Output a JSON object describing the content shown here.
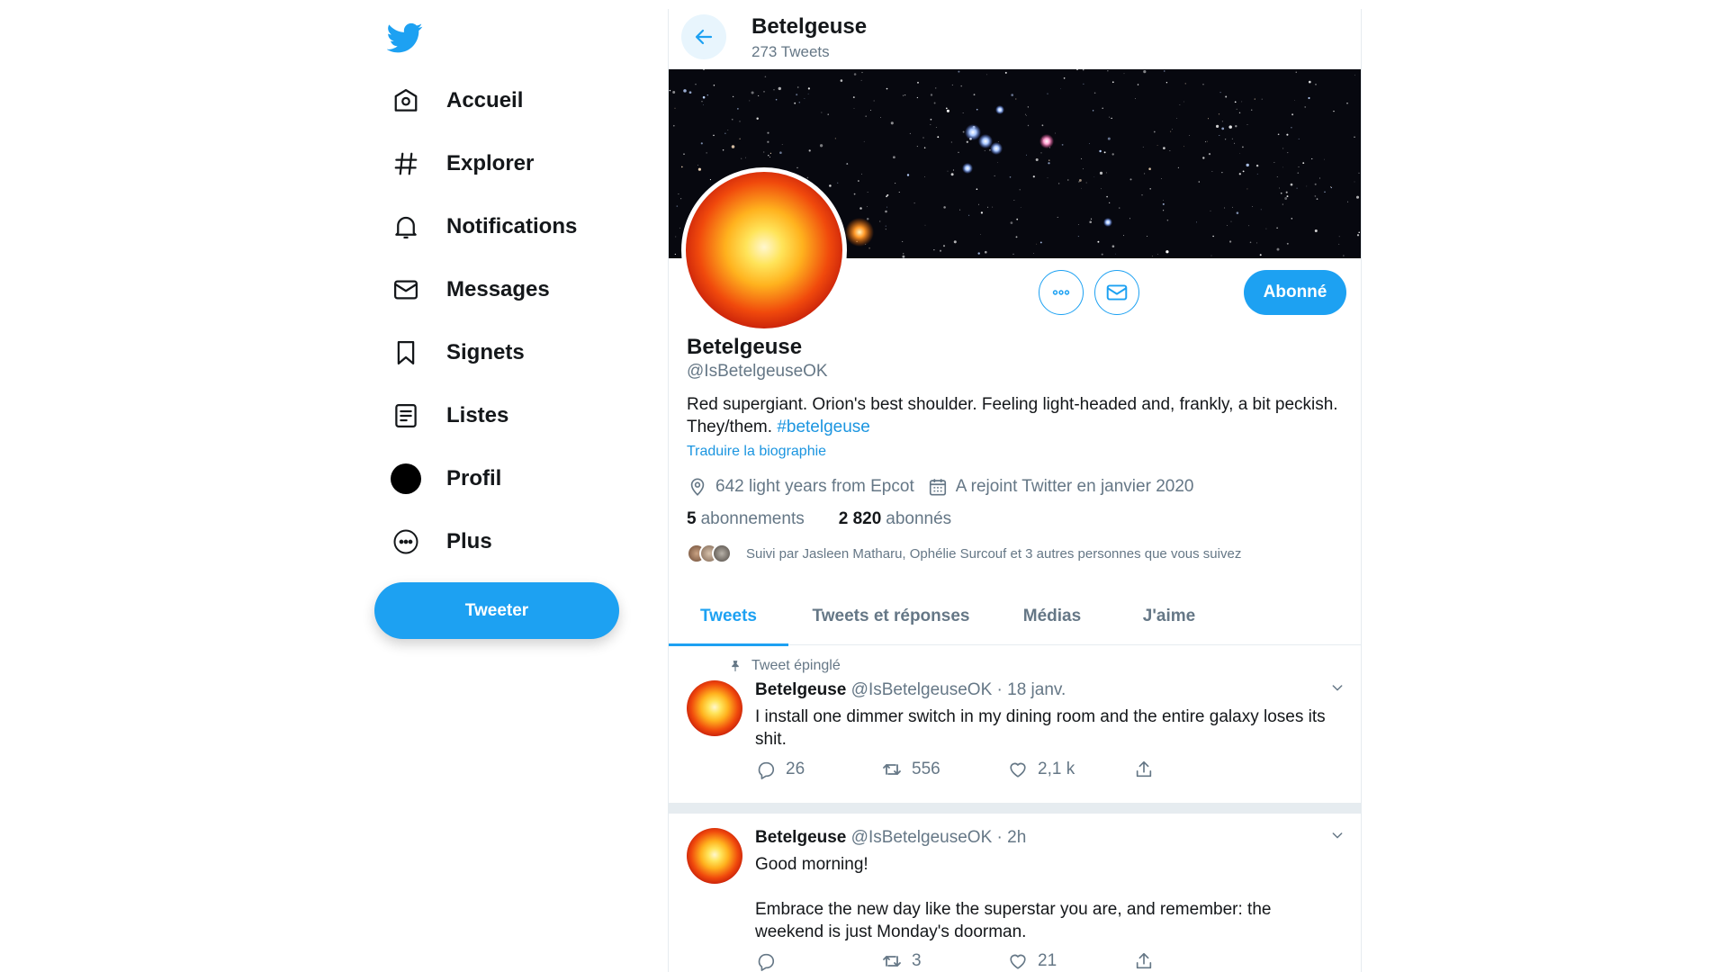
{
  "colors": {
    "accent": "#1da1f2",
    "link": "#1b95e0",
    "text": "#14171a",
    "muted": "#657786",
    "border": "#e6ecf0"
  },
  "sidebar": {
    "logo_icon": "twitter-bird-icon",
    "items": [
      {
        "label": "Accueil",
        "icon": "home-icon"
      },
      {
        "label": "Explorer",
        "icon": "hashtag-icon"
      },
      {
        "label": "Notifications",
        "icon": "bell-icon"
      },
      {
        "label": "Messages",
        "icon": "envelope-icon"
      },
      {
        "label": "Signets",
        "icon": "bookmark-icon"
      },
      {
        "label": "Listes",
        "icon": "list-icon"
      },
      {
        "label": "Profil",
        "icon": "profile-avatar-icon"
      },
      {
        "label": "Plus",
        "icon": "more-circle-icon"
      }
    ],
    "tweet_button": "Tweeter"
  },
  "header": {
    "title": "Betelgeuse",
    "subtitle": "273 Tweets"
  },
  "profile": {
    "name": "Betelgeuse",
    "handle": "@IsBetelgeuseOK",
    "bio_text": "Red supergiant. Orion's best shoulder. Feeling light-headed and, frankly, a bit peckish. They/them. ",
    "bio_hashtag": "#betelgeuse",
    "translate_link": "Traduire la biographie",
    "location": "642 light years from Epcot",
    "joined": "A rejoint Twitter en janvier 2020",
    "following_count": "5",
    "following_label": "abonnements",
    "followers_count": "2 820",
    "followers_label": "abonnés",
    "followed_by": "Suivi par Jasleen Matharu, Ophélie Surcouf et 3 autres personnes que vous suivez",
    "follow_button": "Abonné"
  },
  "tabs": [
    "Tweets",
    "Tweets et réponses",
    "Médias",
    "J'aime"
  ],
  "tweets": [
    {
      "pinned_label": "Tweet épinglé",
      "name": "Betelgeuse",
      "meta": "@IsBetelgeuseOK · 18 janv.",
      "text": "I install one dimmer switch in my dining room and the entire galaxy loses its shit.",
      "replies": "26",
      "retweets": "556",
      "likes": "2,1 k"
    },
    {
      "name": "Betelgeuse",
      "meta": "@IsBetelgeuseOK · 2h",
      "text": "Good morning!\n\nEmbrace the new day like the superstar you are, and remember: the weekend is just Monday's doorman.",
      "replies": "",
      "retweets": "3",
      "likes": "21"
    }
  ]
}
